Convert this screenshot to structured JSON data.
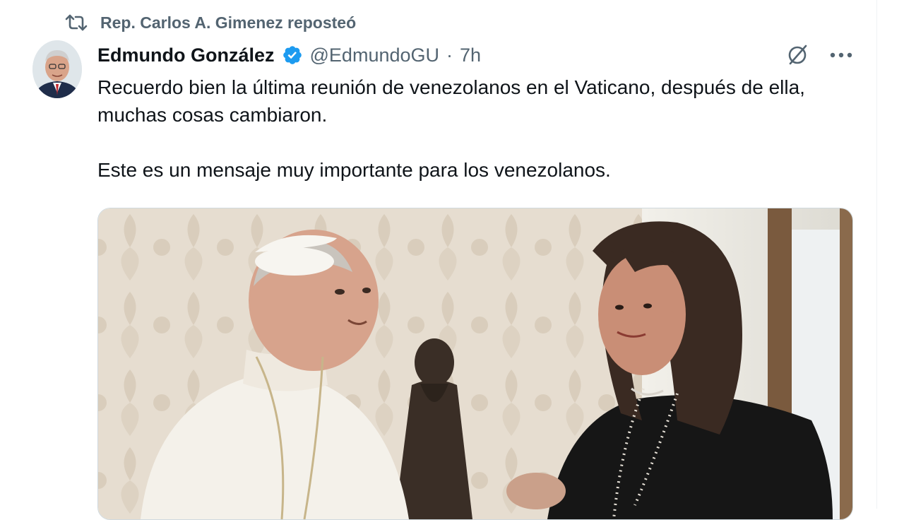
{
  "repost": {
    "icon": "repost-icon",
    "label": "Rep. Carlos A. Gimenez reposteó"
  },
  "tweet": {
    "author": {
      "name": "Edmundo González",
      "handle": "@EdmundoGU",
      "verified": true,
      "verified_color": "#1d9bf0"
    },
    "separator": "·",
    "time": "7h",
    "actions": {
      "grok_icon": "grok-slash-circle-icon",
      "more_icon": "more-horizontal-icon"
    },
    "text": {
      "paragraph1": "Recuerdo bien la última reunión de venezolanos en el Vaticano, después de ella, muchas cosas cambiaron.",
      "paragraph2": "Este es un mensaje muy importante para los venezolanos."
    },
    "media": {
      "type": "photo"
    }
  }
}
